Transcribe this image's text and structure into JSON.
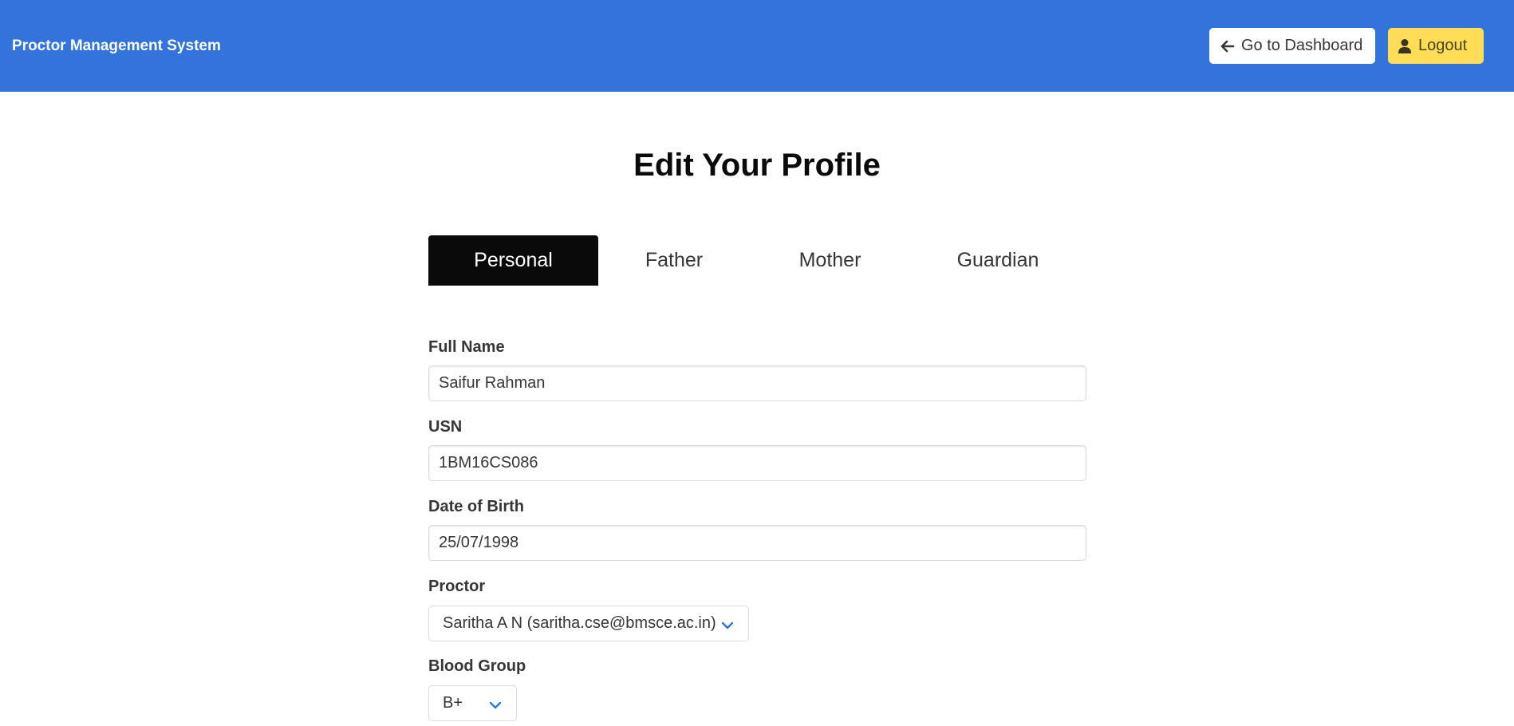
{
  "navbar": {
    "brand": "Proctor Management System",
    "dashboard_label": "Go to Dashboard",
    "logout_label": "Logout"
  },
  "page": {
    "title": "Edit Your Profile"
  },
  "tabs": [
    {
      "label": "Personal",
      "active": true
    },
    {
      "label": "Father",
      "active": false
    },
    {
      "label": "Mother",
      "active": false
    },
    {
      "label": "Guardian",
      "active": false
    }
  ],
  "form": {
    "full_name": {
      "label": "Full Name",
      "value": "Saifur Rahman"
    },
    "usn": {
      "label": "USN",
      "value": "1BM16CS086"
    },
    "dob": {
      "label": "Date of Birth",
      "value": "25/07/1998"
    },
    "proctor": {
      "label": "Proctor",
      "selected": "Saritha A N (saritha.cse@bmsce.ac.in)"
    },
    "blood_group": {
      "label": "Blood Group",
      "selected": "B+"
    }
  },
  "colors": {
    "navbar": "#3273dc",
    "active_tab": "#0a0a0a",
    "logout_button": "#ffdd57",
    "chevron": "#3273dc"
  },
  "icons": {
    "dashboard": "arrow-left-icon",
    "logout": "user-icon",
    "select": "chevron-down-icon"
  }
}
